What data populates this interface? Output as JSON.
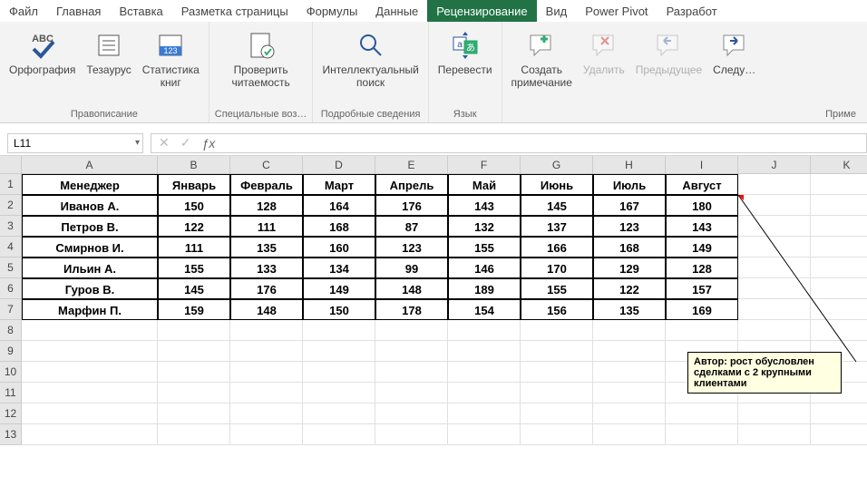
{
  "tabs": {
    "items": [
      "Файл",
      "Главная",
      "Вставка",
      "Разметка страницы",
      "Формулы",
      "Данные",
      "Рецензирование",
      "Вид",
      "Power Pivot",
      "Разработ"
    ],
    "active_index": 6
  },
  "ribbon": {
    "groups": [
      {
        "label": "Правописание",
        "items": [
          {
            "name": "spelling",
            "label": "Орфография"
          },
          {
            "name": "thesaurus",
            "label": "Тезаурус"
          },
          {
            "name": "stats",
            "label": "Статистика\nкниг"
          }
        ]
      },
      {
        "label": "Специальные воз…",
        "items": [
          {
            "name": "check-access",
            "label": "Проверить\nчитаемость"
          }
        ]
      },
      {
        "label": "Подробные сведения",
        "items": [
          {
            "name": "smart-lookup",
            "label": "Интеллектуальный\nпоиск"
          }
        ]
      },
      {
        "label": "Язык",
        "items": [
          {
            "name": "translate",
            "label": "Перевести"
          }
        ]
      },
      {
        "label": "Приме",
        "items": [
          {
            "name": "new-comment",
            "label": "Создать\nпримечание"
          },
          {
            "name": "delete-comment",
            "label": "Удалить",
            "disabled": true
          },
          {
            "name": "prev-comment",
            "label": "Предыдущее",
            "disabled": true
          },
          {
            "name": "next-comment",
            "label": "Следу…"
          }
        ]
      }
    ]
  },
  "namebox": {
    "value": "L11"
  },
  "columns": [
    "A",
    "B",
    "C",
    "D",
    "E",
    "F",
    "G",
    "H",
    "I",
    "J",
    "K"
  ],
  "row_numbers": [
    1,
    2,
    3,
    4,
    5,
    6,
    7,
    8,
    9,
    10,
    11,
    12,
    13
  ],
  "table": {
    "headers": [
      "Менеджер",
      "Январь",
      "Февраль",
      "Март",
      "Апрель",
      "Май",
      "Июнь",
      "Июль",
      "Август"
    ],
    "rows": [
      [
        "Иванов А.",
        150,
        128,
        164,
        176,
        143,
        145,
        167,
        180
      ],
      [
        "Петров В.",
        122,
        111,
        168,
        87,
        132,
        137,
        123,
        143
      ],
      [
        "Смирнов И.",
        111,
        135,
        160,
        123,
        155,
        166,
        168,
        149
      ],
      [
        "Ильин А.",
        155,
        133,
        134,
        99,
        146,
        170,
        129,
        128
      ],
      [
        "Гуров В.",
        145,
        176,
        149,
        148,
        189,
        155,
        122,
        157
      ],
      [
        "Марфин П.",
        159,
        148,
        150,
        178,
        154,
        156,
        135,
        169
      ]
    ]
  },
  "comment": {
    "text": "Автор: рост обусловлен сделками с 2 крупными клиентами"
  },
  "icons": {
    "abc": "ABC",
    "fx": "ƒx",
    "check": "✓",
    "x": "✕",
    "dd": "▾"
  }
}
